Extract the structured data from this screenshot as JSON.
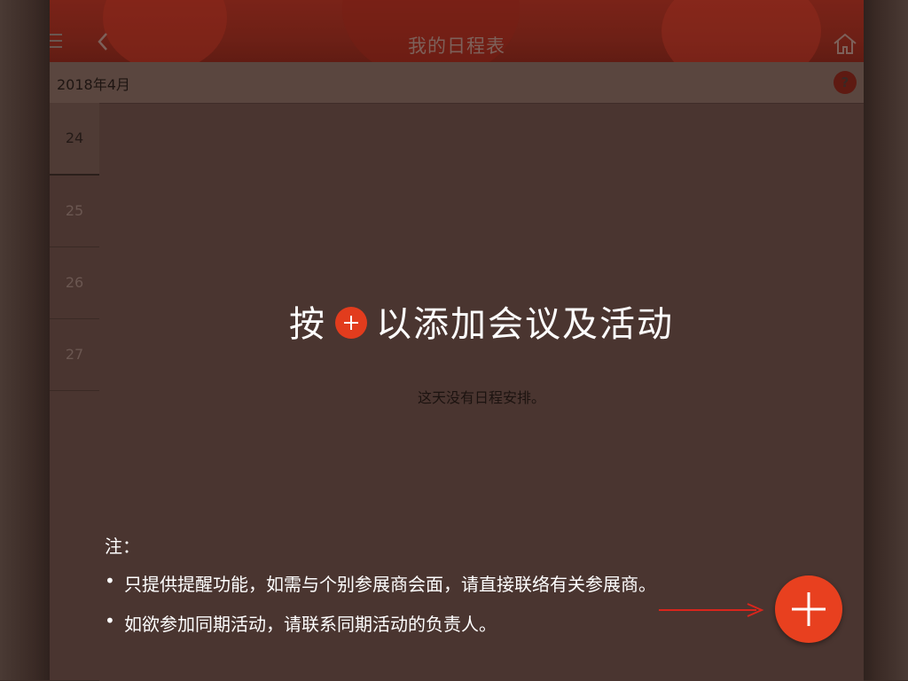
{
  "header": {
    "title": "我的日程表",
    "menu_icon": "menu-icon",
    "back_icon": "chevron-left-icon",
    "home_icon": "home-icon"
  },
  "month_bar": {
    "label": "2018年4月",
    "help_label": "?"
  },
  "days": [
    {
      "label": "24",
      "active": true
    },
    {
      "label": "25",
      "active": false
    },
    {
      "label": "26",
      "active": false
    },
    {
      "label": "27",
      "active": false
    }
  ],
  "hint": {
    "prefix": "按",
    "suffix": "以添加会议及活动"
  },
  "empty_message": "这天没有日程安排。",
  "notes": {
    "title": "注：",
    "items": [
      "只提供提醒功能，如需与个别参展商会面，请直接联络有关参展商。",
      "如欲参加同期活动，请联系同期活动的负责人。"
    ]
  },
  "colors": {
    "accent": "#e8401f",
    "header": "#6e2016",
    "overlay": "#4a3530"
  }
}
